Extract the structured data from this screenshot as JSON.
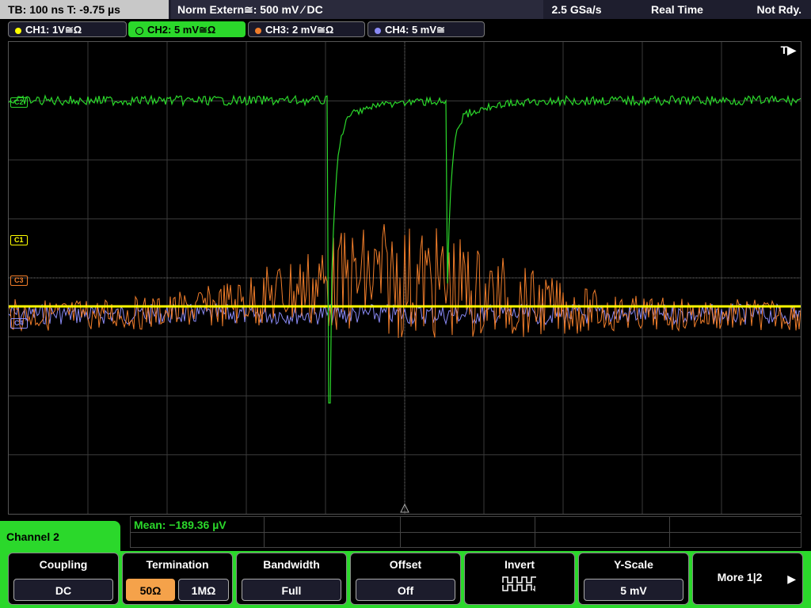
{
  "status": {
    "timebase": "TB: 100 ns   T: -9.75 µs",
    "trigger": "Norm    Extern≅: 500 mV ⁄ DC",
    "sample_rate": "2.5 GSa/s",
    "acq_mode": "Real Time",
    "state": "Not Rdy."
  },
  "channels": [
    {
      "label": "CH1: 1V≅Ω",
      "color": "#ffff00"
    },
    {
      "label": "CH2: 5 mV≅Ω",
      "color": "#2bd82b"
    },
    {
      "label": "CH3: 2 mV≅Ω",
      "color": "#f07d2a"
    },
    {
      "label": "CH4: 5 mV≅",
      "color": "#8a8af5"
    }
  ],
  "plot": {
    "trigger_indicator": "T▶",
    "markers": [
      "C2",
      "C1",
      "C3",
      "C4"
    ]
  },
  "measurement": {
    "text": "Mean: −189.36 µV"
  },
  "panel": {
    "title": "Channel 2"
  },
  "softkeys": {
    "coupling": {
      "title": "Coupling",
      "value": "DC"
    },
    "termination": {
      "title": "Termination",
      "opt1": "50Ω",
      "opt2": "1MΩ"
    },
    "bandwidth": {
      "title": "Bandwidth",
      "value": "Full"
    },
    "offset": {
      "title": "Offset",
      "value": "Off"
    },
    "invert": {
      "title": "Invert",
      "icon": "invert-waveform-icon"
    },
    "yscale": {
      "title": "Y-Scale",
      "value": "5 mV"
    },
    "more": {
      "label": "More 1|2"
    }
  }
}
